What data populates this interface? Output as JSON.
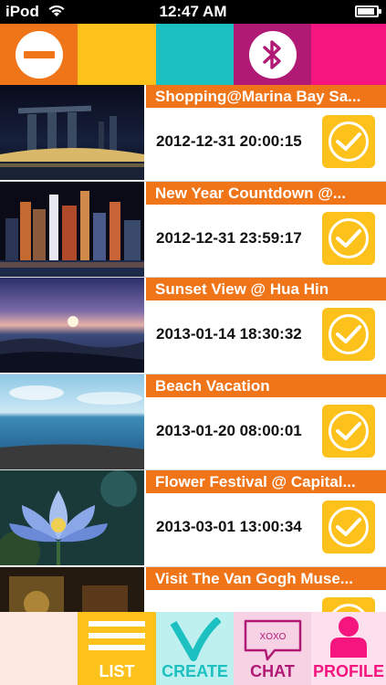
{
  "status_bar": {
    "carrier": "iPod",
    "time": "12:47 AM",
    "battery_level": 0.9
  },
  "topbar": {
    "colors": [
      "#f07418",
      "#fcc11a",
      "#1cc0c0",
      "#b01a74",
      "#f5157e"
    ],
    "left_button_icon": "minus-circle-icon",
    "bluetooth_icon": "bluetooth-icon"
  },
  "events": [
    {
      "title": "Shopping@Marina Bay Sa...",
      "datetime": "2012-12-31 20:00:15",
      "thumb": "city-night-marina"
    },
    {
      "title": "New Year Countdown @...",
      "datetime": "2012-12-31 23:59:17",
      "thumb": "city-night-skyline"
    },
    {
      "title": "Sunset View @ Hua Hin",
      "datetime": "2013-01-14 18:30:32",
      "thumb": "sunset-sea"
    },
    {
      "title": "Beach Vacation",
      "datetime": "2013-01-20 08:00:01",
      "thumb": "beach"
    },
    {
      "title": "Flower Festival @ Capital...",
      "datetime": "2013-03-01 13:00:34",
      "thumb": "lotus-flower"
    },
    {
      "title": "Visit The Van Gogh Muse...",
      "datetime": "",
      "thumb": "museum"
    }
  ],
  "tabs": [
    {
      "label": "LIST",
      "icon": "list-icon",
      "bg": "#fcc11a",
      "fg": "#ffffff"
    },
    {
      "label": "CREATE",
      "icon": "create-check-icon",
      "bg": "#bff0f0",
      "fg": "#1cc0c0"
    },
    {
      "label": "CHAT",
      "icon": "chat-bubble-icon",
      "bg": "#f7d1e4",
      "fg": "#b01a74",
      "bubble_text": "XOXO"
    },
    {
      "label": "PROFILE",
      "icon": "profile-icon",
      "bg": "#fde0ee",
      "fg": "#f5157e"
    }
  ]
}
